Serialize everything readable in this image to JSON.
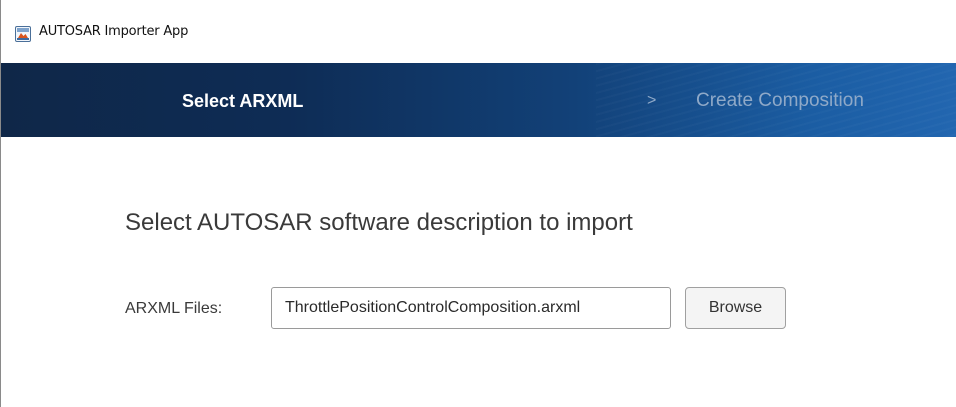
{
  "window": {
    "title": "AUTOSAR Importer App",
    "icon": "matlab-app-icon"
  },
  "wizard": {
    "steps": [
      {
        "label": "Select ARXML",
        "state": "active"
      },
      {
        "label": "Create Composition",
        "state": "inactive"
      }
    ],
    "separator": ">",
    "colors": {
      "header_dark": "#0f2748",
      "header_light": "#2266b0",
      "active_text": "#ffffff",
      "inactive_text": "#8fa9c8"
    }
  },
  "main": {
    "heading": "Select AUTOSAR software description to import",
    "arxml_field": {
      "label": "ARXML Files:",
      "value": "ThrottlePositionControlComposition.arxml"
    },
    "browse_label": "Browse"
  }
}
